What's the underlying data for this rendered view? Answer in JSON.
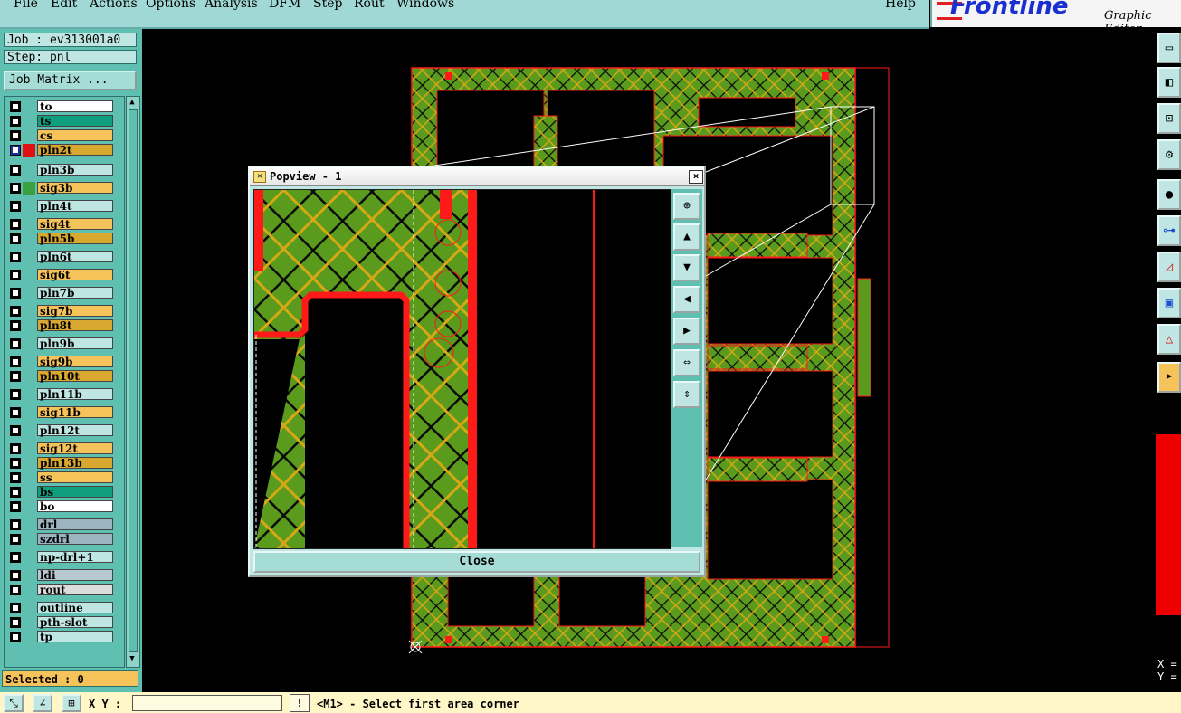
{
  "menu": {
    "items": [
      "File",
      "Edit",
      "Actions",
      "Options",
      "Analysis",
      "DFM",
      "Step",
      "Rout",
      "Windows"
    ],
    "help": "Help"
  },
  "logo": {
    "brand": "Frontline",
    "subtitle": "Graphic Editor"
  },
  "job": {
    "job_label": "Job : ev313001a0",
    "step_label": "Step: pnl",
    "matrix_button": "Job Matrix ..."
  },
  "layers": [
    {
      "name": "to",
      "color": "#ffffff",
      "swatch": ""
    },
    {
      "name": "ts",
      "color": "#0f9f7f",
      "swatch": ""
    },
    {
      "name": "cs",
      "color": "#f6c25a",
      "swatch": ""
    },
    {
      "name": "pln2t",
      "color": "#d9a830",
      "swatch": "#e01010",
      "active": true
    },
    {
      "name": "pln3b",
      "color": "#bfe6e2",
      "swatch": ""
    },
    {
      "name": "sig3b",
      "color": "#f6c25a",
      "swatch": "#3aa040"
    },
    {
      "name": "pln4t",
      "color": "#bfe6e2",
      "swatch": ""
    },
    {
      "name": "sig4t",
      "color": "#f6c25a",
      "swatch": ""
    },
    {
      "name": "pln5b",
      "color": "#d9a830",
      "swatch": ""
    },
    {
      "name": "pln6t",
      "color": "#bfe6e2",
      "swatch": ""
    },
    {
      "name": "sig6t",
      "color": "#f6c25a",
      "swatch": ""
    },
    {
      "name": "pln7b",
      "color": "#bfe6e2",
      "swatch": ""
    },
    {
      "name": "sig7b",
      "color": "#f6c25a",
      "swatch": ""
    },
    {
      "name": "pln8t",
      "color": "#d9a830",
      "swatch": ""
    },
    {
      "name": "pln9b",
      "color": "#bfe6e2",
      "swatch": ""
    },
    {
      "name": "sig9b",
      "color": "#f6c25a",
      "swatch": ""
    },
    {
      "name": "pln10t",
      "color": "#d9a830",
      "swatch": ""
    },
    {
      "name": "pln11b",
      "color": "#bfe6e2",
      "swatch": ""
    },
    {
      "name": "sig11b",
      "color": "#f6c25a",
      "swatch": ""
    },
    {
      "name": "pln12t",
      "color": "#bfe6e2",
      "swatch": ""
    },
    {
      "name": "sig12t",
      "color": "#f6c25a",
      "swatch": ""
    },
    {
      "name": "pln13b",
      "color": "#d9a830",
      "swatch": ""
    },
    {
      "name": "ss",
      "color": "#f6c25a",
      "swatch": ""
    },
    {
      "name": "bs",
      "color": "#0f9f7f",
      "swatch": ""
    },
    {
      "name": "bo",
      "color": "#ffffff",
      "swatch": ""
    },
    {
      "name": "drl",
      "color": "#9bb4c0",
      "swatch": ""
    },
    {
      "name": "szdrl",
      "color": "#9bb4c0",
      "swatch": ""
    },
    {
      "name": "np-drl+1",
      "color": "#bfe6e2",
      "swatch": ""
    },
    {
      "name": "ldi",
      "color": "#b8c8d0",
      "swatch": ""
    },
    {
      "name": "rout",
      "color": "#dcdcdc",
      "swatch": ""
    },
    {
      "name": "outline",
      "color": "#bfe6e2",
      "swatch": ""
    },
    {
      "name": "pth-slot",
      "color": "#bfe6e2",
      "swatch": ""
    },
    {
      "name": "tp",
      "color": "#bfe6e2",
      "swatch": ""
    }
  ],
  "selected_label": "Selected : 0",
  "bottom": {
    "xy_label": "X Y :",
    "xy_value": "",
    "excl": "!",
    "status": "<M1> - Select first area corner"
  },
  "readout": {
    "x": "X =",
    "y": "Y ="
  },
  "popview": {
    "title": "Popview - 1",
    "close_x": "×",
    "close_button": "Close"
  },
  "colors": {
    "board_green": "#5a9a1c",
    "hatch_black": "#0a0a0a",
    "hatch_yellow": "#d7a815",
    "outline_red": "#ff1a1a",
    "panel_teal": "#5fbfb0"
  }
}
